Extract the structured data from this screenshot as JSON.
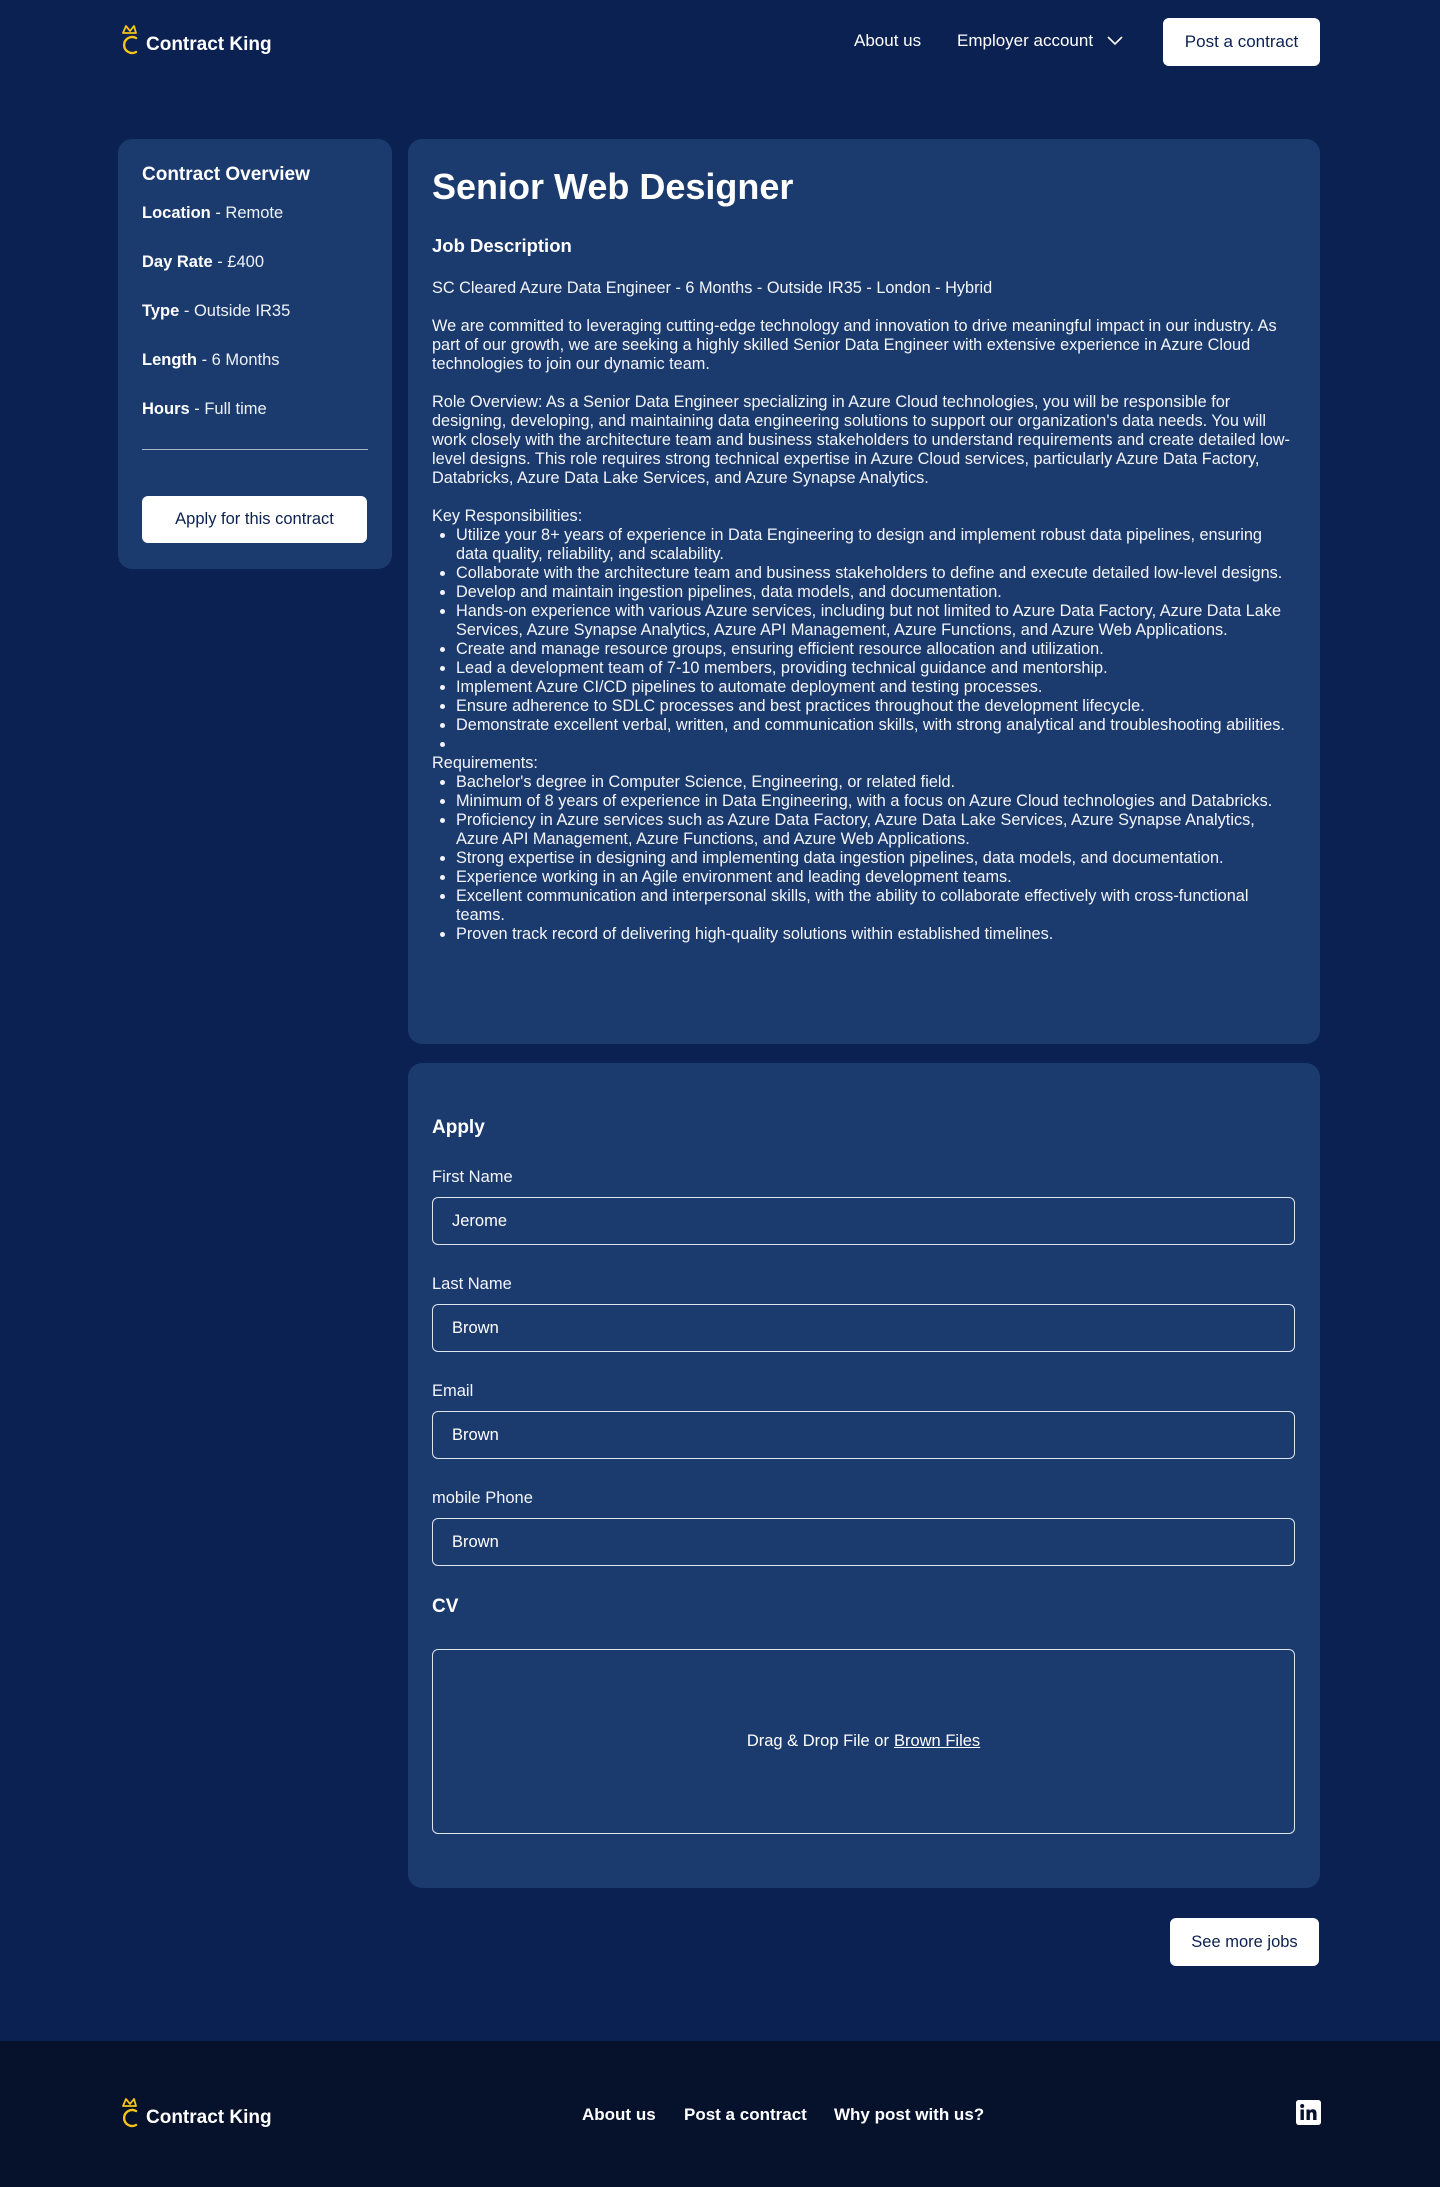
{
  "header": {
    "logo_text": "Contract King",
    "nav": {
      "about": "About us",
      "employer": "Employer account"
    },
    "post_button": "Post a contract"
  },
  "overview": {
    "title": "Contract Overview",
    "rows": [
      {
        "label": "Location",
        "value": " - Remote"
      },
      {
        "label": "Day Rate",
        "value": " - £400"
      },
      {
        "label": "Type",
        "value": " - Outside IR35"
      },
      {
        "label": "Length",
        "value": " - 6 Months"
      },
      {
        "label": "Hours",
        "value": " - Full time"
      }
    ],
    "apply_button": "Apply for this contract"
  },
  "job": {
    "title": "Senior Web Designer",
    "description_heading": "Job Description",
    "summary_line": "SC Cleared Azure Data Engineer - 6 Months - Outside IR35 - London - Hybrid",
    "intro": "We are committed to leveraging cutting-edge technology and innovation to drive meaningful impact in our industry. As part of our growth, we are seeking a highly skilled Senior Data Engineer with extensive experience in Azure Cloud technologies to join our dynamic team.",
    "role_overview": "Role Overview: As a Senior Data Engineer specializing in Azure Cloud technologies, you will be responsible for designing, developing, and maintaining data engineering solutions to support our organization's data needs. You will work closely with the architecture team and business stakeholders to understand requirements and create detailed low-level designs. This role requires strong technical expertise in Azure Cloud services, particularly Azure Data Factory, Databricks, Azure Data Lake Services, and Azure Synapse Analytics.",
    "responsibilities_label": "Key Responsibilities:",
    "responsibilities": [
      "Utilize your 8+ years of experience in Data Engineering to design and implement robust data pipelines, ensuring data quality, reliability, and scalability.",
      "Collaborate with the architecture team and business stakeholders to define and execute detailed low-level designs.",
      "Develop and maintain ingestion pipelines, data models, and documentation.",
      "Hands-on experience with various Azure services, including but not limited to Azure Data Factory, Azure Data Lake Services, Azure Synapse Analytics, Azure API Management, Azure Functions, and Azure Web Applications.",
      "Create and manage resource groups, ensuring efficient resource allocation and utilization.",
      "Lead a development team of 7-10 members, providing technical guidance and mentorship.",
      "Implement Azure CI/CD pipelines to automate deployment and testing processes.",
      "Ensure adherence to SDLC processes and best practices throughout the development lifecycle.",
      "Demonstrate excellent verbal, written, and communication skills, with strong analytical and troubleshooting abilities.",
      ""
    ],
    "requirements_label": "Requirements:",
    "requirements": [
      "Bachelor's degree in Computer Science, Engineering, or related field.",
      "Minimum of 8 years of experience in Data Engineering, with a focus on Azure Cloud technologies and Databricks.",
      "Proficiency in Azure services such as Azure Data Factory, Azure Data Lake Services, Azure Synapse Analytics, Azure API Management, Azure Functions, and Azure Web Applications.",
      "Strong expertise in designing and implementing data ingestion pipelines, data models, and documentation.",
      "Experience working in an Agile environment and leading development teams.",
      "Excellent communication and interpersonal skills, with the ability to collaborate effectively with cross-functional teams.",
      "Proven track record of delivering high-quality solutions within established timelines."
    ]
  },
  "apply": {
    "heading": "Apply",
    "fields": [
      {
        "label": "First Name",
        "value": "Jerome"
      },
      {
        "label": "Last Name",
        "value": "Brown"
      },
      {
        "label": "Email",
        "value": "Brown"
      },
      {
        "label": "mobile Phone",
        "value": "Brown"
      }
    ],
    "cv_heading": "CV",
    "dropzone_text": "Drag & Drop File or",
    "dropzone_link": "Brown Files"
  },
  "more_jobs_button": "See more jobs",
  "footer": {
    "logo_text": "Contract King",
    "links": [
      "About us",
      "Post a contract",
      "Why post with us?"
    ],
    "social_icon": "linkedin-icon"
  },
  "colors": {
    "page_bg": "#0b2152",
    "card_bg": "#1b3a6e",
    "footer_bg": "#06122c",
    "crown": "#f5c518",
    "button_bg": "#ffffff",
    "button_text": "#0b2152"
  }
}
